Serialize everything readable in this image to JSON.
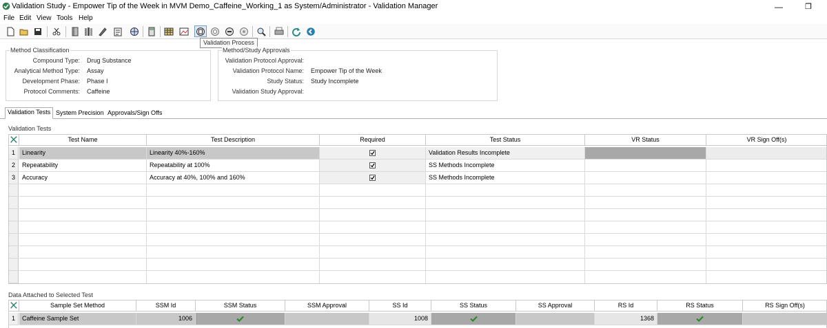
{
  "window": {
    "title": "Validation Study - Empower Tip of the Week in MVM Demo_Caffeine_Working_1 as System/Administrator - Validation Manager",
    "min_glyph": "—",
    "max_glyph": "❐"
  },
  "menu": [
    "File",
    "Edit",
    "View",
    "Tools",
    "Help"
  ],
  "toolbar": {
    "tooltip": "Validation Process",
    "icons": [
      "new-doc-icon",
      "open-folder-icon",
      "save-icon",
      "scissors-icon",
      "book-icon",
      "books-icon",
      "pen-icon",
      "report-icon",
      "globe-icon",
      "calculator-icon",
      "table-icon",
      "image-report-icon",
      "validation-process-icon",
      "protocol-icon",
      "link-icon",
      "gear-icon",
      "magnifier-icon",
      "print-icon",
      "refresh-icon",
      "back-icon"
    ]
  },
  "method_classification": {
    "title": "Method Classification",
    "fields": [
      {
        "label": "Compound Type:",
        "value": "Drug Substance"
      },
      {
        "label": "Analytical Method Type:",
        "value": "Assay"
      },
      {
        "label": "Development Phase:",
        "value": "Phase I"
      },
      {
        "label": "Protocol Comments:",
        "value": "Caffeine"
      }
    ]
  },
  "approvals": {
    "title": "Method/Study Approvals",
    "fields": [
      {
        "label": "Validation Protocol Approval:",
        "value": ""
      },
      {
        "label": "Validation Protocol Name:",
        "value": "Empower Tip of the Week"
      },
      {
        "label": "Study Status:",
        "value": "Study Incomplete"
      },
      {
        "label": "Validation Study Approval:",
        "value": ""
      }
    ]
  },
  "tabs": [
    "Validation Tests",
    "System Precision",
    "Approvals/Sign Offs"
  ],
  "validation_tests": {
    "section_label": "Validation Tests",
    "columns": [
      "Test Name",
      "Test Description",
      "Required",
      "Test Status",
      "VR Status",
      "VR Sign Off(s)"
    ],
    "rows": [
      {
        "num": "1",
        "name": "Linearity",
        "desc": "Linearity 40%-160%",
        "required": true,
        "status": "Validation Results Incomplete",
        "vr_status": "",
        "vr_signoff": ""
      },
      {
        "num": "2",
        "name": "Repeatability",
        "desc": "Repeatability at 100%",
        "required": true,
        "status": "SS Methods Incomplete",
        "vr_status": "",
        "vr_signoff": ""
      },
      {
        "num": "3",
        "name": "Accuracy",
        "desc": "Accuracy at 40%, 100% and 160%",
        "required": true,
        "status": "SS Methods Incomplete",
        "vr_status": "",
        "vr_signoff": ""
      }
    ]
  },
  "data_attached": {
    "section_label": "Data Attached to Selected Test",
    "columns": [
      "Sample Set Method",
      "SSM Id",
      "SSM Status",
      "SSM Approval",
      "SS Id",
      "SS Status",
      "SS Approval",
      "RS Id",
      "RS Status",
      "RS Sign Off(s)"
    ],
    "rows": [
      {
        "num": "1",
        "method": "Caffeine Sample Set",
        "ssm_id": "1006",
        "ssm_status": "ok",
        "ssm_approval": "",
        "ss_id": "1008",
        "ss_status": "ok",
        "ss_approval": "",
        "rs_id": "1368",
        "rs_status": "ok",
        "rs_signoff": ""
      }
    ]
  },
  "colors": {
    "accent": "#2e7d4f",
    "check_green": "#2f8a2f",
    "selected_row": "#c8c8c8"
  }
}
